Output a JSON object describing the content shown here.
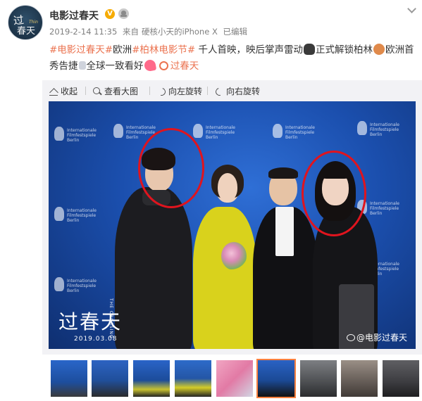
{
  "post": {
    "username": "电影过春天",
    "avatar_text_line1": "过",
    "avatar_text_line2": "春天",
    "avatar_text_en": "Thin",
    "verified_glyph": "V",
    "meta_time": "2019-2-14 11:35",
    "meta_source_prefix": "来自",
    "meta_source": "硬核小天的iPhone X",
    "meta_edited": "已编辑",
    "text": {
      "tag1": "#电影过春天#",
      "seg1": "欧洲",
      "tag2": "#柏林电影节#",
      "seg2": " 千人首映，映后掌声雷动",
      "seg3": "正式解锁柏林",
      "seg4": "欧洲首秀告捷",
      "seg5": "全球一致看好",
      "link": "过春天"
    }
  },
  "toolbar": {
    "collapse": "收起",
    "view_large": "查看大图",
    "rotate_left": "向左旋转",
    "rotate_right": "向右旋转"
  },
  "photo": {
    "film_title": "过春天",
    "film_en": "THE CROSSING",
    "film_date": "2019.03.08",
    "watermark": "@电影过春天",
    "festival_label": "Internationale\nFilmfestspiele\nBerlin"
  },
  "thumbnails": {
    "count": 9,
    "active_index": 5
  },
  "colors": {
    "accent": "#eb7350",
    "verified": "#f6ab00",
    "highlight_circle": "#e0141e",
    "active_thumb_border": "#ff8140",
    "toolbar_bg": "#f2f2f5"
  },
  "icons": [
    "chevron-down-icon",
    "verified-icon",
    "vip-icon",
    "clap-hands-icon",
    "bear-emoji-icon",
    "heart-emoji-icon",
    "link-icon",
    "collapse-icon",
    "zoom-icon",
    "rotate-left-icon",
    "rotate-right-icon",
    "weibo-icon"
  ]
}
